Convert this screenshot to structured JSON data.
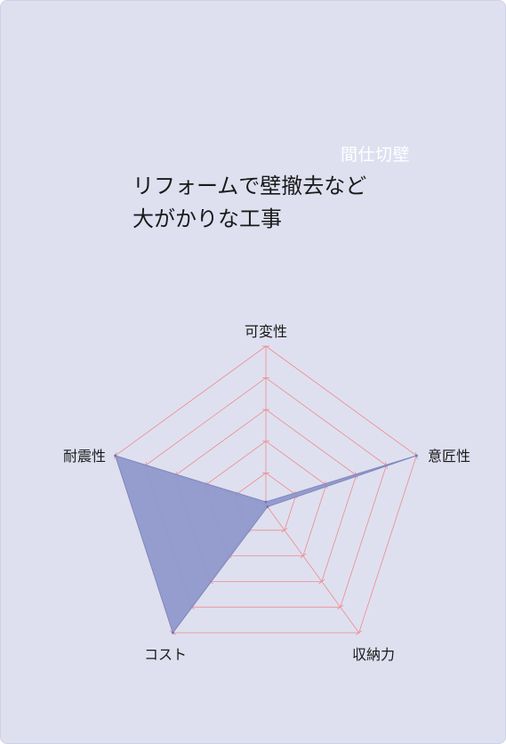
{
  "card": {
    "tag": "間仕切壁",
    "headline_lines": [
      "リフォームで壁撤去など",
      "大がかりな工事"
    ]
  },
  "colors": {
    "background": "#dee0f0",
    "grid": "#f08a8a",
    "fill": "#8e97cc",
    "tag_text": "#ffffff"
  },
  "chart_data": {
    "type": "radar",
    "axes": [
      "可変性",
      "意匠性",
      "収納力",
      "コスト",
      "耐震性"
    ],
    "levels": 5,
    "max": 5,
    "values": [
      0,
      5,
      0,
      5,
      5
    ],
    "grid": true
  }
}
